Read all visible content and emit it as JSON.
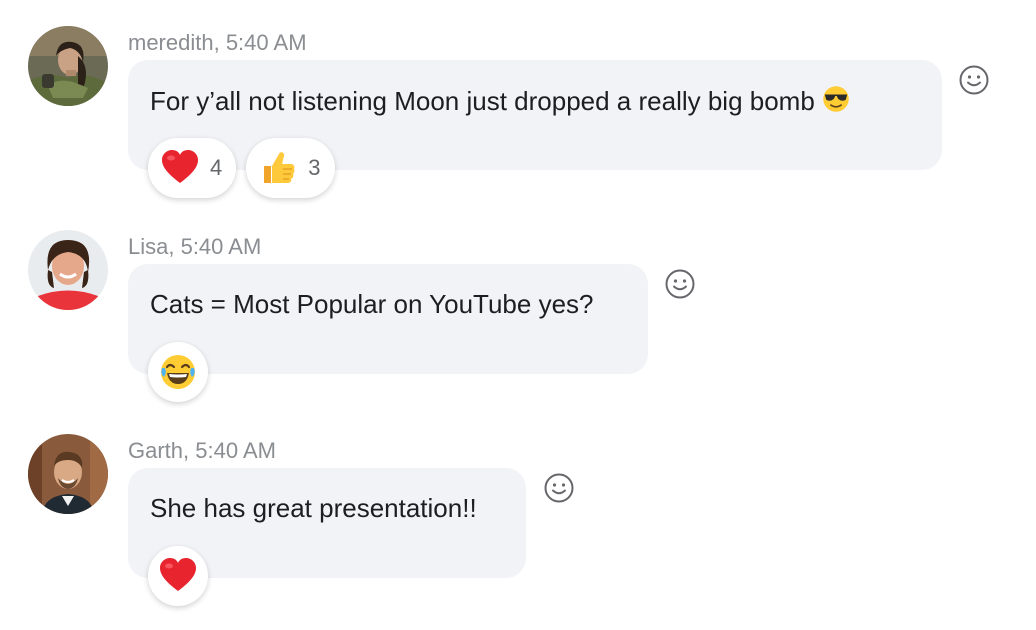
{
  "messages": [
    {
      "author": "meredith",
      "time": "5:40 AM",
      "meta": "meredith, 5:40 AM",
      "text": "For y’all not listening Moon just dropped a really big bomb",
      "inline_emoji": "sunglasses-face",
      "reactions": [
        {
          "icon": "heart",
          "count": "4"
        },
        {
          "icon": "thumbs-up",
          "count": "3"
        }
      ]
    },
    {
      "author": "Lisa",
      "time": "5:40 AM",
      "meta": "Lisa, 5:40 AM",
      "text": "Cats = Most Popular on YouTube yes?",
      "reactions": [
        {
          "icon": "laughing-tears"
        }
      ]
    },
    {
      "author": "Garth",
      "time": "5:40 AM",
      "meta": "Garth, 5:40 AM",
      "text": "She has great presentation!!",
      "reactions": [
        {
          "icon": "heart"
        }
      ]
    }
  ],
  "colors": {
    "bubble": "#f1f3f6",
    "meta_text": "#8a8d91",
    "heart": "#e8242f",
    "emoji_yellow": "#ffcc33"
  }
}
